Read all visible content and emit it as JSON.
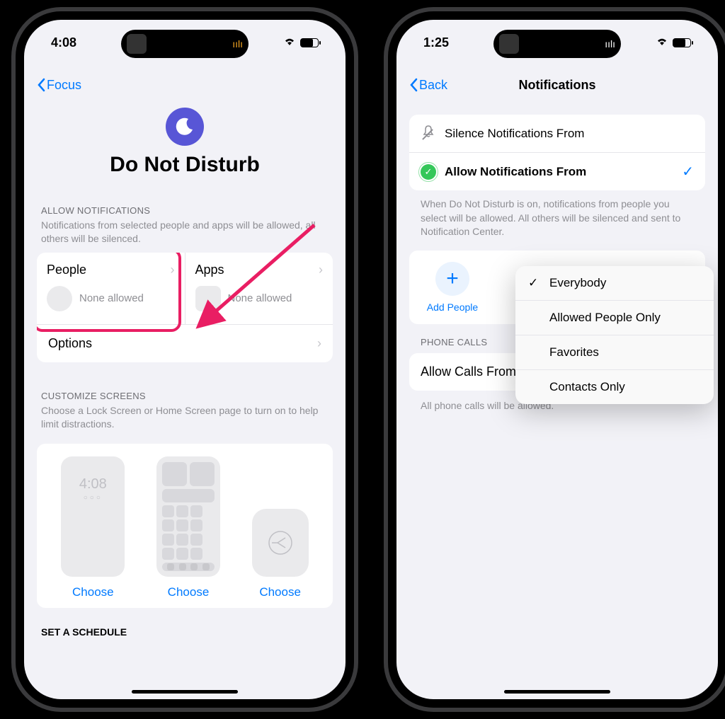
{
  "left": {
    "time": "4:08",
    "back": "Focus",
    "title": "Do Not Disturb",
    "sec1_header": "ALLOW NOTIFICATIONS",
    "sec1_desc": "Notifications from selected people and apps will be allowed, all others will be silenced.",
    "people": "People",
    "people_sub": "None allowed",
    "apps": "Apps",
    "apps_sub": "None allowed",
    "options": "Options",
    "sec2_header": "CUSTOMIZE SCREENS",
    "sec2_desc": "Choose a Lock Screen or Home Screen page to turn on to help limit distractions.",
    "choose": "Choose",
    "lock_time": "4:08",
    "sec3_header": "SET A SCHEDULE"
  },
  "right": {
    "time": "1:25",
    "back": "Back",
    "title": "Notifications",
    "silence": "Silence Notifications From",
    "allow": "Allow Notifications From",
    "desc": "When Do Not Disturb is on, notifications from people you select will be allowed. All others will be silenced and sent to Notification Center.",
    "add_people": "Add People",
    "popover": [
      "Everybody",
      "Allowed People Only",
      "Favorites",
      "Contacts Only"
    ],
    "phone_calls_header": "PHONE CALLS",
    "allow_calls": "Allow Calls From",
    "allow_calls_value": "Everybody",
    "calls_desc": "All phone calls will be allowed."
  }
}
